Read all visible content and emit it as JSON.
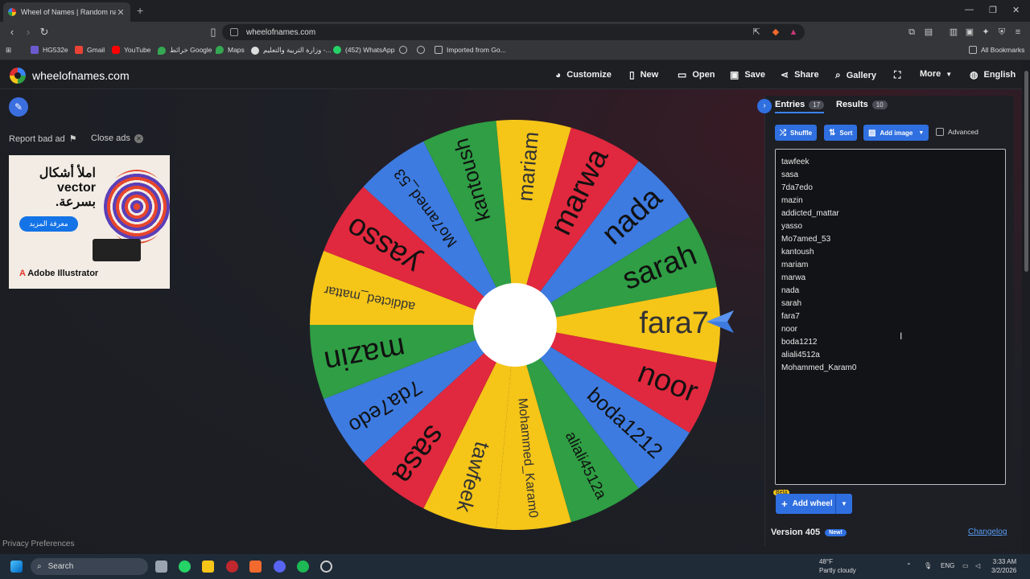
{
  "browser": {
    "tab_title": "Wheel of Names | Random name",
    "url": "wheelofnames.com",
    "bookmarks": [
      {
        "label": "HG532e"
      },
      {
        "label": "Gmail"
      },
      {
        "label": "YouTube"
      },
      {
        "label": "خرائط Google"
      },
      {
        "label": "Maps"
      },
      {
        "label": "وزارة التربية والتعليم -..."
      },
      {
        "label": "(452) WhatsApp"
      },
      {
        "label": "Imported from Go..."
      }
    ],
    "all_bookmarks": "All Bookmarks"
  },
  "site": {
    "logo_text": "wheelofnames.com",
    "nav": {
      "customize": "Customize",
      "new": "New",
      "open": "Open",
      "save": "Save",
      "share": "Share",
      "gallery": "Gallery",
      "more": "More",
      "language": "English"
    }
  },
  "ads": {
    "report": "Report bad ad",
    "close": "Close ads",
    "ad_headline_1": "املأ أشكال",
    "ad_headline_2": "vector",
    "ad_headline_3": "بسرعة.",
    "ad_cta": "معرفة المزيد",
    "ad_brand": "Adobe Illustrator"
  },
  "privacy": "Privacy Preferences",
  "wheel": {
    "colors": [
      "#2f9e44",
      "#f5c518",
      "#e0283e",
      "#3d7be0"
    ],
    "center_color": "#ffffff",
    "segments": [
      "tawfeek",
      "sasa",
      "7da7edo",
      "mazin",
      "addicted_mattar",
      "yasso",
      "Mo7amed_53",
      "kantoush",
      "mariam",
      "marwa",
      "nada",
      "sarah",
      "fara7",
      "noor",
      "boda1212",
      "aliali4512a",
      "Mohammed_Karam0"
    ]
  },
  "panel": {
    "entries_tab": "Entries",
    "entries_count": "17",
    "results_tab": "Results",
    "results_count": "10",
    "shuffle": "Shuffle",
    "sort": "Sort",
    "add_image": "Add image",
    "advanced": "Advanced",
    "entries": [
      "tawfeek",
      "sasa",
      "7da7edo",
      "mazin",
      "addicted_mattar",
      "yasso",
      "Mo7amed_53",
      "kantoush",
      "mariam",
      "marwa",
      "nada",
      "sarah",
      "fara7",
      "noor",
      "boda1212",
      "aliali4512a",
      "Mohammed_Karam0"
    ],
    "beta": "Beta",
    "add_wheel": "Add wheel",
    "version": "Version 405",
    "new_badge": "New!",
    "changelog": "Changelog"
  },
  "taskbar": {
    "search": "Search",
    "temperature": "48°F",
    "weather": "Partly cloudy",
    "lang": "ENG",
    "time": "3:33 AM",
    "date": "3/2/2026"
  }
}
